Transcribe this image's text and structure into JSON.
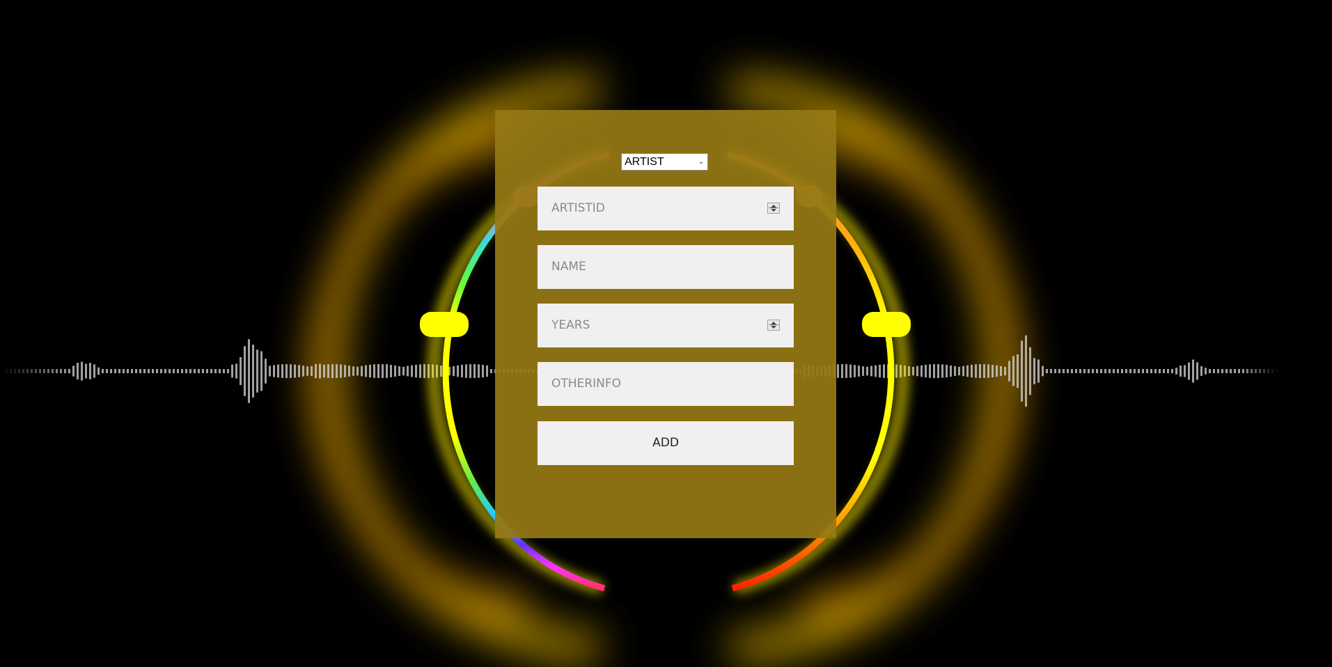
{
  "form": {
    "type_select": {
      "selected": "ARTIST",
      "icon": "chevron-down-icon"
    },
    "fields": [
      {
        "placeholder": "ARTISTID",
        "kind": "number"
      },
      {
        "placeholder": "NAME",
        "kind": "text"
      },
      {
        "placeholder": "YEARS",
        "kind": "number"
      },
      {
        "placeholder": "OTHERINFO",
        "kind": "text"
      }
    ],
    "submit_label": "ADD"
  },
  "colors": {
    "background": "#000000",
    "panel": "#967814",
    "field_bg": "#f0f0f0",
    "placeholder": "#8a8a8a",
    "glow": "#ffd700"
  }
}
